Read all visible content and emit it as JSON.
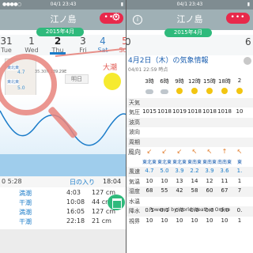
{
  "status": {
    "time": "04/1 23:43",
    "left_time": "04/1 23:43"
  },
  "left": {
    "title": "江ノ島",
    "month": "2015年4月",
    "dates": [
      {
        "num": "31",
        "dow": "Tue"
      },
      {
        "num": "1",
        "dow": "Wed"
      },
      {
        "num": "2",
        "dow": "Thu"
      },
      {
        "num": "3",
        "dow": "Fri"
      },
      {
        "num": "4",
        "dow": "Sat"
      },
      {
        "num": "5",
        "dow": "Sun"
      }
    ],
    "coords": "35.30N 139.29E",
    "moon_label": "明日",
    "tide_kind": "大潮",
    "wind_badge_1": "東北東",
    "wind_val_1": "4.7",
    "wind_badge_2": "東北東",
    "wind_val_2": "5.0",
    "moonrise": "0  5:28",
    "sunset_label": "日の入り",
    "sunset": "18:04",
    "tides": [
      {
        "label": "満潮",
        "time": "4:03",
        "height": "127 cm"
      },
      {
        "label": "干潮",
        "time": "10:08",
        "height": "44 cm"
      },
      {
        "label": "満潮",
        "time": "16:05",
        "height": "127 cm"
      },
      {
        "label": "干潮",
        "time": "22:18",
        "height": "21 cm"
      }
    ]
  },
  "right": {
    "title": "江ノ島",
    "month": "2015年4月",
    "dim_numbers": [
      "0",
      "6"
    ],
    "header": "4月2日（木）の気象情報",
    "updated": "04/01 22:59 時点",
    "hours": [
      "3時",
      "6時",
      "9時",
      "12時",
      "15時",
      "18時",
      "2"
    ],
    "rows": {
      "weather": "天気",
      "pressure": {
        "label": "気圧",
        "values": [
          "1015",
          "1018",
          "1019",
          "1018",
          "1018",
          "1018",
          "10"
        ]
      },
      "wave_height": "波高",
      "wave_dir": "波向",
      "wave_period": "周期",
      "wind_dir_label": "風向",
      "wind_dirs": [
        "東北東",
        "東北東",
        "東北東",
        "東南東",
        "東南東",
        "南南東",
        "東"
      ],
      "wind_speed": {
        "label": "風速",
        "values": [
          "4.7",
          "5.0",
          "3.9",
          "2.2",
          "3.9",
          "3.6",
          "1."
        ]
      },
      "temp": {
        "label": "気温",
        "values": [
          "10",
          "10",
          "13",
          "14",
          "12",
          "11",
          "1"
        ]
      },
      "humidity": {
        "label": "湿度",
        "values": [
          "68",
          "55",
          "42",
          "58",
          "60",
          "67",
          "7"
        ]
      },
      "water_temp": "水温",
      "precip": {
        "label": "降水",
        "values": [
          "0.1",
          "0.1",
          "0.0",
          "0.0",
          "0.0",
          "0.0",
          "0."
        ]
      },
      "visibility": {
        "label": "視界",
        "values": [
          "10",
          "10",
          "10",
          "10",
          "10",
          "10",
          "1"
        ]
      }
    },
    "powered": "Powered by World Weather Online"
  },
  "icons": {
    "menu": "menu-dots-icon",
    "gear": "gear-icon",
    "info": "info-icon",
    "calendar": "calendar-icon"
  },
  "colors": {
    "accent_green": "#2fba7c",
    "menu_red": "#e8294b",
    "link_blue": "#1b7cc9",
    "nav_gray": "#9fb0b5"
  }
}
